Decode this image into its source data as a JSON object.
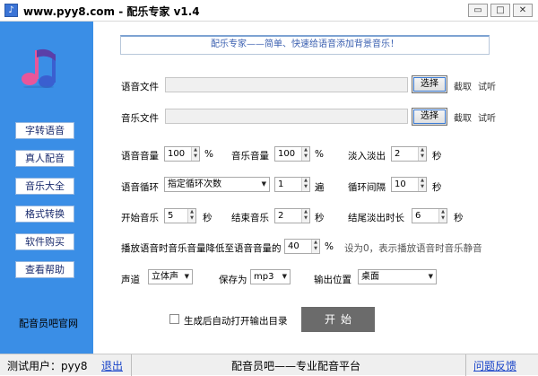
{
  "window": {
    "title": "www.pyy8.com - 配乐专家 v1.4",
    "controls": [
      "▭",
      "□",
      "✕"
    ]
  },
  "sidebar": {
    "items": [
      "字转语音",
      "真人配音",
      "音乐大全",
      "格式转换",
      "软件购买",
      "查看帮助"
    ],
    "footer": "配音员吧官网"
  },
  "main": {
    "banner": "配乐专家——简单、快速给语音添加背景音乐！",
    "voice_file": {
      "label": "语音文件",
      "value": "",
      "choose": "选择",
      "clip": "截取",
      "listen": "试听"
    },
    "music_file": {
      "label": "音乐文件",
      "value": "",
      "choose": "选择",
      "clip": "截取",
      "listen": "试听"
    },
    "voice_volume": {
      "label": "语音音量",
      "value": "100",
      "unit": "%"
    },
    "music_volume": {
      "label": "音乐音量",
      "value": "100",
      "unit": "%"
    },
    "fade": {
      "label": "淡入淡出",
      "value": "2",
      "unit": "秒"
    },
    "voice_loop": {
      "label": "语音循环",
      "option": "指定循环次数",
      "value": "1",
      "unit": "遍"
    },
    "loop_interval": {
      "label": "循环间隔",
      "value": "10",
      "unit": "秒"
    },
    "start_music": {
      "label": "开始音乐",
      "value": "5",
      "unit": "秒"
    },
    "end_music": {
      "label": "结束音乐",
      "value": "2",
      "unit": "秒"
    },
    "tail_fade": {
      "label": "结尾淡出时长",
      "value": "6",
      "unit": "秒"
    },
    "duck": {
      "label": "播放语音时音乐音量降低至语音音量的",
      "value": "40",
      "unit": "%",
      "hint": "设为0，表示播放语音时音乐静音"
    },
    "channel": {
      "label": "声道",
      "value": "立体声"
    },
    "save_as": {
      "label": "保存为",
      "value": "mp3"
    },
    "output": {
      "label": "输出位置",
      "value": "桌面"
    },
    "auto_open": {
      "label": "生成后自动打开输出目录",
      "checked": false
    },
    "start_button": "开始"
  },
  "statusbar": {
    "user": "测试用户：pyy8",
    "logout": "退出",
    "center": "配音员吧——专业配音平台",
    "feedback": "问题反馈"
  }
}
